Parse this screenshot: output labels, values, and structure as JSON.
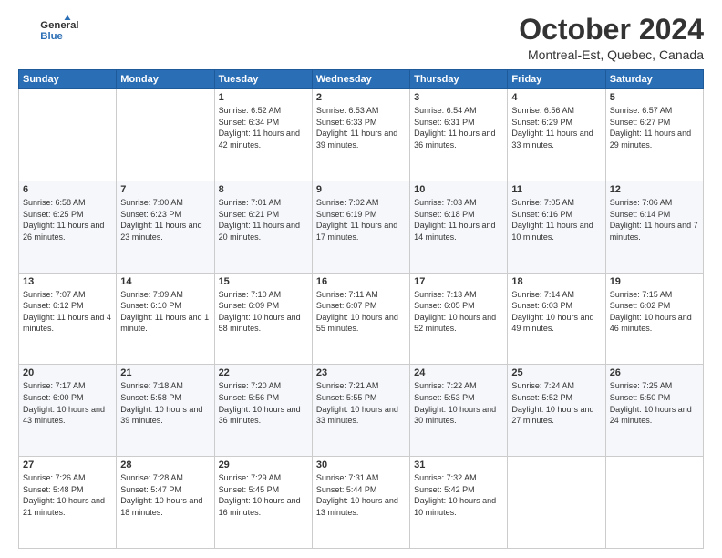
{
  "header": {
    "logo_general": "General",
    "logo_blue": "Blue",
    "month": "October 2024",
    "location": "Montreal-Est, Quebec, Canada"
  },
  "days_of_week": [
    "Sunday",
    "Monday",
    "Tuesday",
    "Wednesday",
    "Thursday",
    "Friday",
    "Saturday"
  ],
  "weeks": [
    [
      {
        "day": "",
        "info": ""
      },
      {
        "day": "",
        "info": ""
      },
      {
        "day": "1",
        "info": "Sunrise: 6:52 AM\nSunset: 6:34 PM\nDaylight: 11 hours and 42 minutes."
      },
      {
        "day": "2",
        "info": "Sunrise: 6:53 AM\nSunset: 6:33 PM\nDaylight: 11 hours and 39 minutes."
      },
      {
        "day": "3",
        "info": "Sunrise: 6:54 AM\nSunset: 6:31 PM\nDaylight: 11 hours and 36 minutes."
      },
      {
        "day": "4",
        "info": "Sunrise: 6:56 AM\nSunset: 6:29 PM\nDaylight: 11 hours and 33 minutes."
      },
      {
        "day": "5",
        "info": "Sunrise: 6:57 AM\nSunset: 6:27 PM\nDaylight: 11 hours and 29 minutes."
      }
    ],
    [
      {
        "day": "6",
        "info": "Sunrise: 6:58 AM\nSunset: 6:25 PM\nDaylight: 11 hours and 26 minutes."
      },
      {
        "day": "7",
        "info": "Sunrise: 7:00 AM\nSunset: 6:23 PM\nDaylight: 11 hours and 23 minutes."
      },
      {
        "day": "8",
        "info": "Sunrise: 7:01 AM\nSunset: 6:21 PM\nDaylight: 11 hours and 20 minutes."
      },
      {
        "day": "9",
        "info": "Sunrise: 7:02 AM\nSunset: 6:19 PM\nDaylight: 11 hours and 17 minutes."
      },
      {
        "day": "10",
        "info": "Sunrise: 7:03 AM\nSunset: 6:18 PM\nDaylight: 11 hours and 14 minutes."
      },
      {
        "day": "11",
        "info": "Sunrise: 7:05 AM\nSunset: 6:16 PM\nDaylight: 11 hours and 10 minutes."
      },
      {
        "day": "12",
        "info": "Sunrise: 7:06 AM\nSunset: 6:14 PM\nDaylight: 11 hours and 7 minutes."
      }
    ],
    [
      {
        "day": "13",
        "info": "Sunrise: 7:07 AM\nSunset: 6:12 PM\nDaylight: 11 hours and 4 minutes."
      },
      {
        "day": "14",
        "info": "Sunrise: 7:09 AM\nSunset: 6:10 PM\nDaylight: 11 hours and 1 minute."
      },
      {
        "day": "15",
        "info": "Sunrise: 7:10 AM\nSunset: 6:09 PM\nDaylight: 10 hours and 58 minutes."
      },
      {
        "day": "16",
        "info": "Sunrise: 7:11 AM\nSunset: 6:07 PM\nDaylight: 10 hours and 55 minutes."
      },
      {
        "day": "17",
        "info": "Sunrise: 7:13 AM\nSunset: 6:05 PM\nDaylight: 10 hours and 52 minutes."
      },
      {
        "day": "18",
        "info": "Sunrise: 7:14 AM\nSunset: 6:03 PM\nDaylight: 10 hours and 49 minutes."
      },
      {
        "day": "19",
        "info": "Sunrise: 7:15 AM\nSunset: 6:02 PM\nDaylight: 10 hours and 46 minutes."
      }
    ],
    [
      {
        "day": "20",
        "info": "Sunrise: 7:17 AM\nSunset: 6:00 PM\nDaylight: 10 hours and 43 minutes."
      },
      {
        "day": "21",
        "info": "Sunrise: 7:18 AM\nSunset: 5:58 PM\nDaylight: 10 hours and 39 minutes."
      },
      {
        "day": "22",
        "info": "Sunrise: 7:20 AM\nSunset: 5:56 PM\nDaylight: 10 hours and 36 minutes."
      },
      {
        "day": "23",
        "info": "Sunrise: 7:21 AM\nSunset: 5:55 PM\nDaylight: 10 hours and 33 minutes."
      },
      {
        "day": "24",
        "info": "Sunrise: 7:22 AM\nSunset: 5:53 PM\nDaylight: 10 hours and 30 minutes."
      },
      {
        "day": "25",
        "info": "Sunrise: 7:24 AM\nSunset: 5:52 PM\nDaylight: 10 hours and 27 minutes."
      },
      {
        "day": "26",
        "info": "Sunrise: 7:25 AM\nSunset: 5:50 PM\nDaylight: 10 hours and 24 minutes."
      }
    ],
    [
      {
        "day": "27",
        "info": "Sunrise: 7:26 AM\nSunset: 5:48 PM\nDaylight: 10 hours and 21 minutes."
      },
      {
        "day": "28",
        "info": "Sunrise: 7:28 AM\nSunset: 5:47 PM\nDaylight: 10 hours and 18 minutes."
      },
      {
        "day": "29",
        "info": "Sunrise: 7:29 AM\nSunset: 5:45 PM\nDaylight: 10 hours and 16 minutes."
      },
      {
        "day": "30",
        "info": "Sunrise: 7:31 AM\nSunset: 5:44 PM\nDaylight: 10 hours and 13 minutes."
      },
      {
        "day": "31",
        "info": "Sunrise: 7:32 AM\nSunset: 5:42 PM\nDaylight: 10 hours and 10 minutes."
      },
      {
        "day": "",
        "info": ""
      },
      {
        "day": "",
        "info": ""
      }
    ]
  ]
}
